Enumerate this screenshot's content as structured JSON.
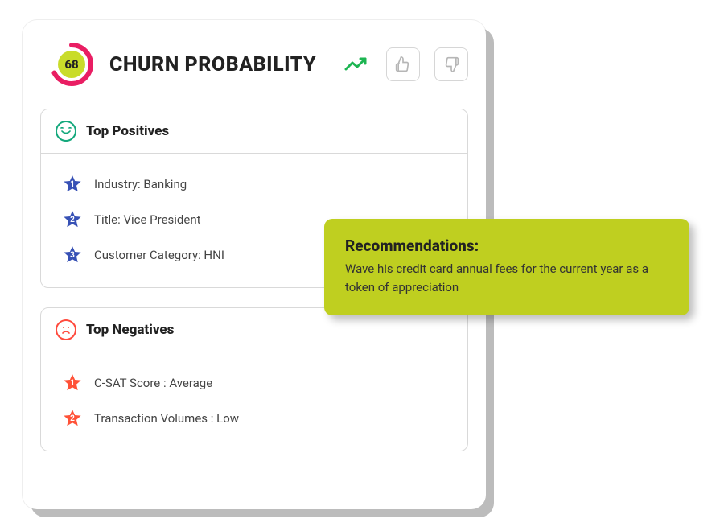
{
  "header": {
    "score": "68",
    "title": "CHURN PROBABILITY"
  },
  "positives": {
    "title": "Top Positives",
    "items": [
      {
        "num": "1",
        "text": "Industry: Banking"
      },
      {
        "num": "2",
        "text": "Title: Vice President"
      },
      {
        "num": "3",
        "text": "Customer Category: HNI"
      }
    ]
  },
  "negatives": {
    "title": "Top Negatives",
    "items": [
      {
        "num": "1",
        "text": "C-SAT Score : Average"
      },
      {
        "num": "2",
        "text": "Transaction Volumes : Low"
      }
    ]
  },
  "recommendations": {
    "title": "Recommendations:",
    "body": "Wave his credit card annual fees for the current year as a token of appreciation"
  },
  "colors": {
    "gauge_ring": "#E91E63",
    "gauge_center": "#C9DC2A",
    "trend": "#1db552",
    "star_pos": "#3751B5",
    "star_neg": "#FF5238",
    "reco_bg": "#BFCF20"
  }
}
